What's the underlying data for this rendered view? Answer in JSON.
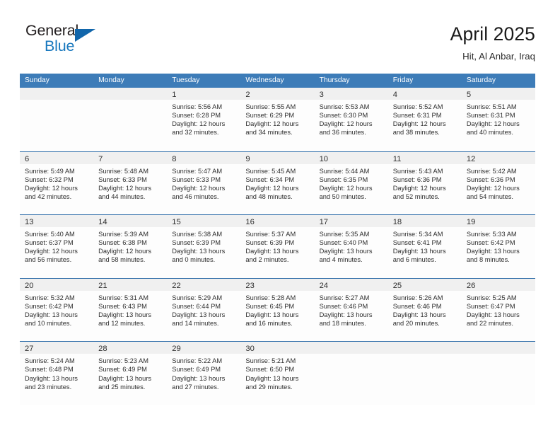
{
  "brand": {
    "name_top": "General",
    "name_bottom": "Blue",
    "accent_color": "#1878be",
    "triangle_color": "#1166ab"
  },
  "header": {
    "title": "April 2025",
    "subtitle": "Hit, Al Anbar, Iraq",
    "header_bar_color": "#3d7cb8",
    "row_divider_color": "#2d6ca8",
    "daynum_band_color": "#f0f0f0"
  },
  "weekdays": [
    "Sunday",
    "Monday",
    "Tuesday",
    "Wednesday",
    "Thursday",
    "Friday",
    "Saturday"
  ],
  "weeks": [
    [
      {
        "day": "",
        "lines": []
      },
      {
        "day": "",
        "lines": []
      },
      {
        "day": "1",
        "lines": [
          "Sunrise: 5:56 AM",
          "Sunset: 6:28 PM",
          "Daylight: 12 hours",
          "and 32 minutes."
        ]
      },
      {
        "day": "2",
        "lines": [
          "Sunrise: 5:55 AM",
          "Sunset: 6:29 PM",
          "Daylight: 12 hours",
          "and 34 minutes."
        ]
      },
      {
        "day": "3",
        "lines": [
          "Sunrise: 5:53 AM",
          "Sunset: 6:30 PM",
          "Daylight: 12 hours",
          "and 36 minutes."
        ]
      },
      {
        "day": "4",
        "lines": [
          "Sunrise: 5:52 AM",
          "Sunset: 6:31 PM",
          "Daylight: 12 hours",
          "and 38 minutes."
        ]
      },
      {
        "day": "5",
        "lines": [
          "Sunrise: 5:51 AM",
          "Sunset: 6:31 PM",
          "Daylight: 12 hours",
          "and 40 minutes."
        ]
      }
    ],
    [
      {
        "day": "6",
        "lines": [
          "Sunrise: 5:49 AM",
          "Sunset: 6:32 PM",
          "Daylight: 12 hours",
          "and 42 minutes."
        ]
      },
      {
        "day": "7",
        "lines": [
          "Sunrise: 5:48 AM",
          "Sunset: 6:33 PM",
          "Daylight: 12 hours",
          "and 44 minutes."
        ]
      },
      {
        "day": "8",
        "lines": [
          "Sunrise: 5:47 AM",
          "Sunset: 6:33 PM",
          "Daylight: 12 hours",
          "and 46 minutes."
        ]
      },
      {
        "day": "9",
        "lines": [
          "Sunrise: 5:45 AM",
          "Sunset: 6:34 PM",
          "Daylight: 12 hours",
          "and 48 minutes."
        ]
      },
      {
        "day": "10",
        "lines": [
          "Sunrise: 5:44 AM",
          "Sunset: 6:35 PM",
          "Daylight: 12 hours",
          "and 50 minutes."
        ]
      },
      {
        "day": "11",
        "lines": [
          "Sunrise: 5:43 AM",
          "Sunset: 6:36 PM",
          "Daylight: 12 hours",
          "and 52 minutes."
        ]
      },
      {
        "day": "12",
        "lines": [
          "Sunrise: 5:42 AM",
          "Sunset: 6:36 PM",
          "Daylight: 12 hours",
          "and 54 minutes."
        ]
      }
    ],
    [
      {
        "day": "13",
        "lines": [
          "Sunrise: 5:40 AM",
          "Sunset: 6:37 PM",
          "Daylight: 12 hours",
          "and 56 minutes."
        ]
      },
      {
        "day": "14",
        "lines": [
          "Sunrise: 5:39 AM",
          "Sunset: 6:38 PM",
          "Daylight: 12 hours",
          "and 58 minutes."
        ]
      },
      {
        "day": "15",
        "lines": [
          "Sunrise: 5:38 AM",
          "Sunset: 6:39 PM",
          "Daylight: 13 hours",
          "and 0 minutes."
        ]
      },
      {
        "day": "16",
        "lines": [
          "Sunrise: 5:37 AM",
          "Sunset: 6:39 PM",
          "Daylight: 13 hours",
          "and 2 minutes."
        ]
      },
      {
        "day": "17",
        "lines": [
          "Sunrise: 5:35 AM",
          "Sunset: 6:40 PM",
          "Daylight: 13 hours",
          "and 4 minutes."
        ]
      },
      {
        "day": "18",
        "lines": [
          "Sunrise: 5:34 AM",
          "Sunset: 6:41 PM",
          "Daylight: 13 hours",
          "and 6 minutes."
        ]
      },
      {
        "day": "19",
        "lines": [
          "Sunrise: 5:33 AM",
          "Sunset: 6:42 PM",
          "Daylight: 13 hours",
          "and 8 minutes."
        ]
      }
    ],
    [
      {
        "day": "20",
        "lines": [
          "Sunrise: 5:32 AM",
          "Sunset: 6:42 PM",
          "Daylight: 13 hours",
          "and 10 minutes."
        ]
      },
      {
        "day": "21",
        "lines": [
          "Sunrise: 5:31 AM",
          "Sunset: 6:43 PM",
          "Daylight: 13 hours",
          "and 12 minutes."
        ]
      },
      {
        "day": "22",
        "lines": [
          "Sunrise: 5:29 AM",
          "Sunset: 6:44 PM",
          "Daylight: 13 hours",
          "and 14 minutes."
        ]
      },
      {
        "day": "23",
        "lines": [
          "Sunrise: 5:28 AM",
          "Sunset: 6:45 PM",
          "Daylight: 13 hours",
          "and 16 minutes."
        ]
      },
      {
        "day": "24",
        "lines": [
          "Sunrise: 5:27 AM",
          "Sunset: 6:46 PM",
          "Daylight: 13 hours",
          "and 18 minutes."
        ]
      },
      {
        "day": "25",
        "lines": [
          "Sunrise: 5:26 AM",
          "Sunset: 6:46 PM",
          "Daylight: 13 hours",
          "and 20 minutes."
        ]
      },
      {
        "day": "26",
        "lines": [
          "Sunrise: 5:25 AM",
          "Sunset: 6:47 PM",
          "Daylight: 13 hours",
          "and 22 minutes."
        ]
      }
    ],
    [
      {
        "day": "27",
        "lines": [
          "Sunrise: 5:24 AM",
          "Sunset: 6:48 PM",
          "Daylight: 13 hours",
          "and 23 minutes."
        ]
      },
      {
        "day": "28",
        "lines": [
          "Sunrise: 5:23 AM",
          "Sunset: 6:49 PM",
          "Daylight: 13 hours",
          "and 25 minutes."
        ]
      },
      {
        "day": "29",
        "lines": [
          "Sunrise: 5:22 AM",
          "Sunset: 6:49 PM",
          "Daylight: 13 hours",
          "and 27 minutes."
        ]
      },
      {
        "day": "30",
        "lines": [
          "Sunrise: 5:21 AM",
          "Sunset: 6:50 PM",
          "Daylight: 13 hours",
          "and 29 minutes."
        ]
      },
      {
        "day": "",
        "lines": []
      },
      {
        "day": "",
        "lines": []
      },
      {
        "day": "",
        "lines": []
      }
    ]
  ]
}
